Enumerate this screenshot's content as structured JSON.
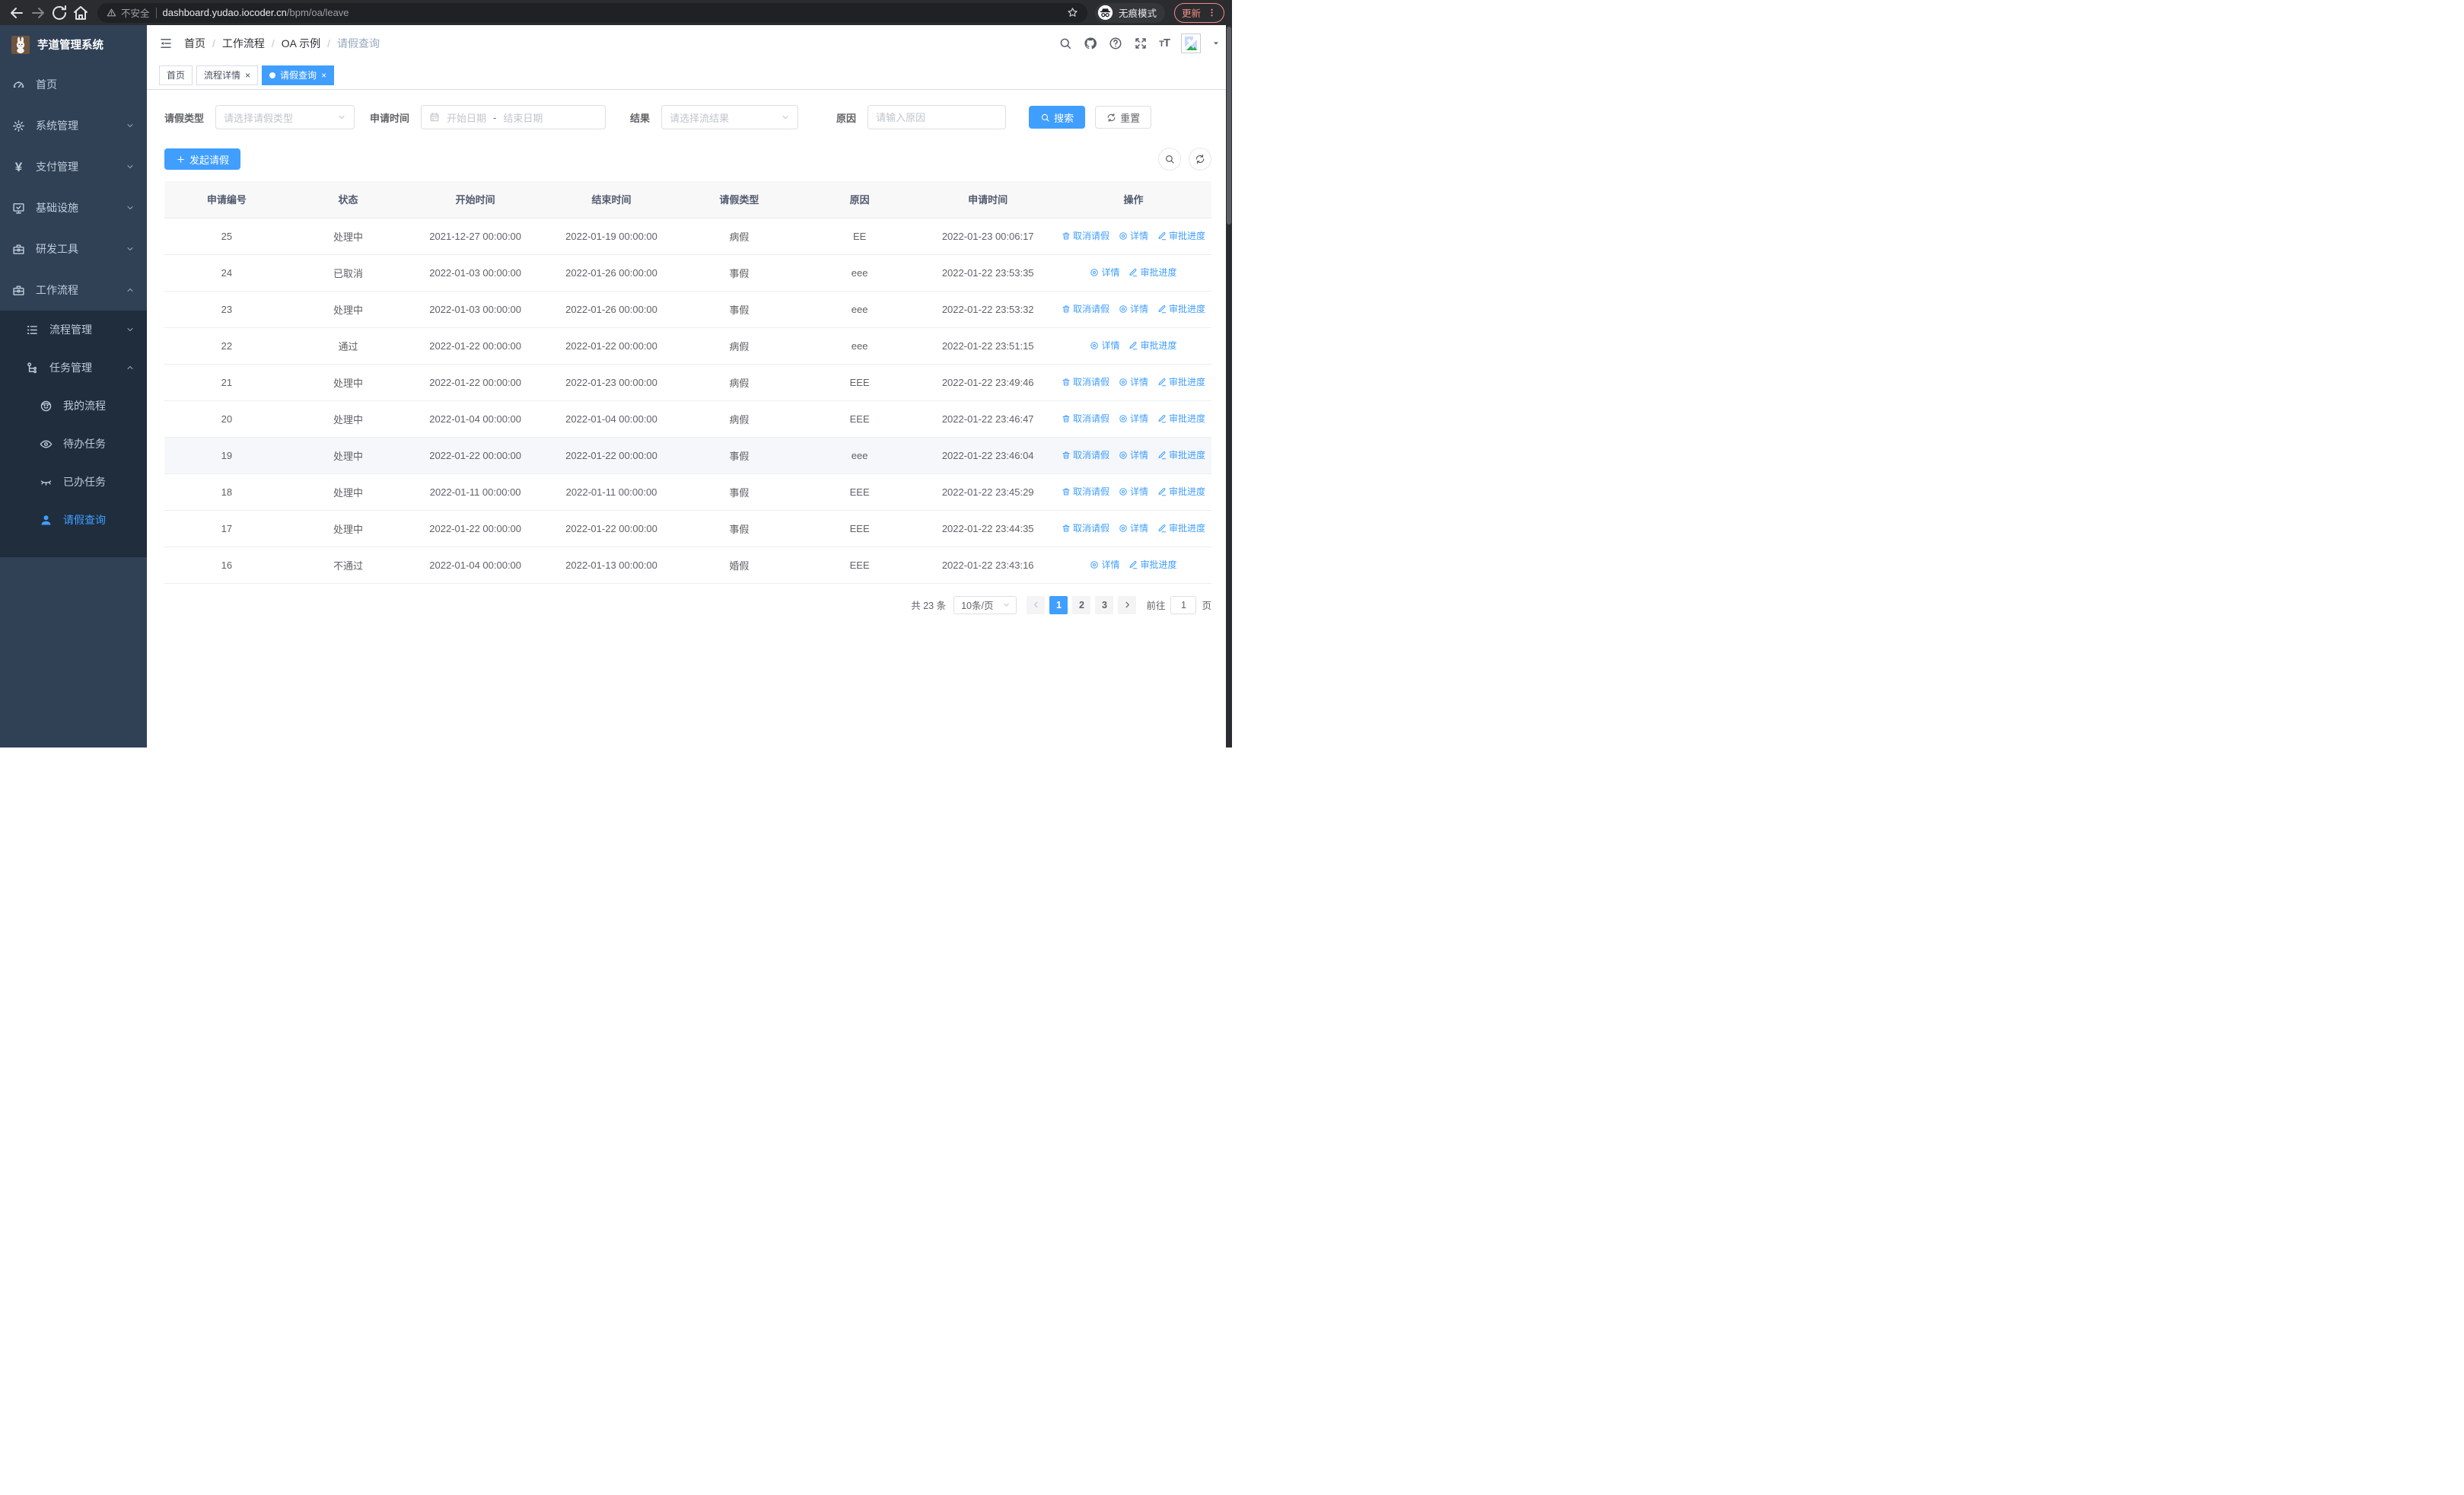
{
  "colors": {
    "accent": "#409eff",
    "sidebar_bg": "#304156",
    "submenu_bg": "#1f2d3d",
    "update_accent": "#f28b82"
  },
  "browser": {
    "security_label": "不安全",
    "url_host": "dashboard.yudao.iocoder.cn",
    "url_path": "/bpm/oa/leave",
    "incognito_label": "无痕模式",
    "update_label": "更新"
  },
  "sidebar": {
    "title": "芋道管理系统",
    "items": [
      {
        "key": "home",
        "label": "首页",
        "icon": "gauge"
      },
      {
        "key": "system-management",
        "label": "系统管理",
        "icon": "gear",
        "expandable": true
      },
      {
        "key": "payment-management",
        "label": "支付管理",
        "icon": "yen",
        "expandable": true
      },
      {
        "key": "infrastructure",
        "label": "基础设施",
        "icon": "monitor",
        "expandable": true
      },
      {
        "key": "dev-tools",
        "label": "研发工具",
        "icon": "briefcase",
        "expandable": true
      },
      {
        "key": "workflow",
        "label": "工作流程",
        "icon": "briefcase",
        "expandable": true,
        "expanded": true
      }
    ],
    "submenu": [
      {
        "key": "process-management",
        "label": "流程管理",
        "icon": "list",
        "expandable": true,
        "level": 2
      },
      {
        "key": "task-management",
        "label": "任务管理",
        "icon": "tree",
        "expandable": true,
        "expanded": true,
        "level": 2
      },
      {
        "key": "my-process",
        "label": "我的流程",
        "icon": "face",
        "level": 3
      },
      {
        "key": "todo-tasks",
        "label": "待办任务",
        "icon": "eye",
        "level": 3
      },
      {
        "key": "done-tasks",
        "label": "已办任务",
        "icon": "eye-closed",
        "level": 3
      },
      {
        "key": "leave-query",
        "label": "请假查询",
        "icon": "user",
        "level": 3,
        "active": true
      }
    ]
  },
  "header": {
    "breadcrumb": {
      "0": "首页",
      "1": "工作流程",
      "2": "OA 示例",
      "3": "请假查询"
    }
  },
  "tabs": [
    {
      "key": "home",
      "label": "首页",
      "closable": false,
      "active": false
    },
    {
      "key": "process-detail",
      "label": "流程详情",
      "closable": true,
      "active": false
    },
    {
      "key": "leave-query",
      "label": "请假查询",
      "closable": true,
      "active": true
    }
  ],
  "filters": {
    "leave_type_label": "请假类型",
    "leave_type_placeholder": "请选择请假类型",
    "apply_time_label": "申请时间",
    "start_date_placeholder": "开始日期",
    "range_separator": "-",
    "end_date_placeholder": "结束日期",
    "result_label": "结果",
    "result_placeholder": "请选择流结果",
    "reason_label": "原因",
    "reason_placeholder": "请输入原因",
    "search_button": "搜索",
    "reset_button": "重置"
  },
  "toolbar": {
    "create_button": "发起请假"
  },
  "table": {
    "columns": [
      "申请编号",
      "状态",
      "开始时间",
      "结束时间",
      "请假类型",
      "原因",
      "申请时间",
      "操作"
    ],
    "action_labels": {
      "cancel": "取消请假",
      "detail": "详情",
      "progress": "审批进度"
    },
    "rows": [
      {
        "id": "25",
        "status": "处理中",
        "start": "2021-12-27 00:00:00",
        "end": "2022-01-19 00:00:00",
        "type": "病假",
        "reason": "EE",
        "apply": "2022-01-23 00:06:17",
        "actions": [
          "cancel",
          "detail",
          "progress"
        ]
      },
      {
        "id": "24",
        "status": "已取消",
        "start": "2022-01-03 00:00:00",
        "end": "2022-01-26 00:00:00",
        "type": "事假",
        "reason": "eee",
        "apply": "2022-01-22 23:53:35",
        "actions": [
          "detail",
          "progress"
        ]
      },
      {
        "id": "23",
        "status": "处理中",
        "start": "2022-01-03 00:00:00",
        "end": "2022-01-26 00:00:00",
        "type": "事假",
        "reason": "eee",
        "apply": "2022-01-22 23:53:32",
        "actions": [
          "cancel",
          "detail",
          "progress"
        ]
      },
      {
        "id": "22",
        "status": "通过",
        "start": "2022-01-22 00:00:00",
        "end": "2022-01-22 00:00:00",
        "type": "病假",
        "reason": "eee",
        "apply": "2022-01-22 23:51:15",
        "actions": [
          "detail",
          "progress"
        ]
      },
      {
        "id": "21",
        "status": "处理中",
        "start": "2022-01-22 00:00:00",
        "end": "2022-01-23 00:00:00",
        "type": "病假",
        "reason": "EEE",
        "apply": "2022-01-22 23:49:46",
        "actions": [
          "cancel",
          "detail",
          "progress"
        ]
      },
      {
        "id": "20",
        "status": "处理中",
        "start": "2022-01-04 00:00:00",
        "end": "2022-01-04 00:00:00",
        "type": "病假",
        "reason": "EEE",
        "apply": "2022-01-22 23:46:47",
        "actions": [
          "cancel",
          "detail",
          "progress"
        ]
      },
      {
        "id": "19",
        "status": "处理中",
        "start": "2022-01-22 00:00:00",
        "end": "2022-01-22 00:00:00",
        "type": "事假",
        "reason": "eee",
        "apply": "2022-01-22 23:46:04",
        "actions": [
          "cancel",
          "detail",
          "progress"
        ],
        "highlight": true
      },
      {
        "id": "18",
        "status": "处理中",
        "start": "2022-01-11 00:00:00",
        "end": "2022-01-11 00:00:00",
        "type": "事假",
        "reason": "EEE",
        "apply": "2022-01-22 23:45:29",
        "actions": [
          "cancel",
          "detail",
          "progress"
        ]
      },
      {
        "id": "17",
        "status": "处理中",
        "start": "2022-01-22 00:00:00",
        "end": "2022-01-22 00:00:00",
        "type": "事假",
        "reason": "EEE",
        "apply": "2022-01-22 23:44:35",
        "actions": [
          "cancel",
          "detail",
          "progress"
        ]
      },
      {
        "id": "16",
        "status": "不通过",
        "start": "2022-01-04 00:00:00",
        "end": "2022-01-13 00:00:00",
        "type": "婚假",
        "reason": "EEE",
        "apply": "2022-01-22 23:43:16",
        "actions": [
          "detail",
          "progress"
        ]
      }
    ]
  },
  "pagination": {
    "total": "共 23 条",
    "page_size": "10条/页",
    "pages": [
      {
        "label": "1",
        "active": true
      },
      {
        "label": "2",
        "active": false
      },
      {
        "label": "3",
        "active": false
      }
    ],
    "goto_label": "前往",
    "goto_value": "1",
    "page_unit": "页"
  }
}
